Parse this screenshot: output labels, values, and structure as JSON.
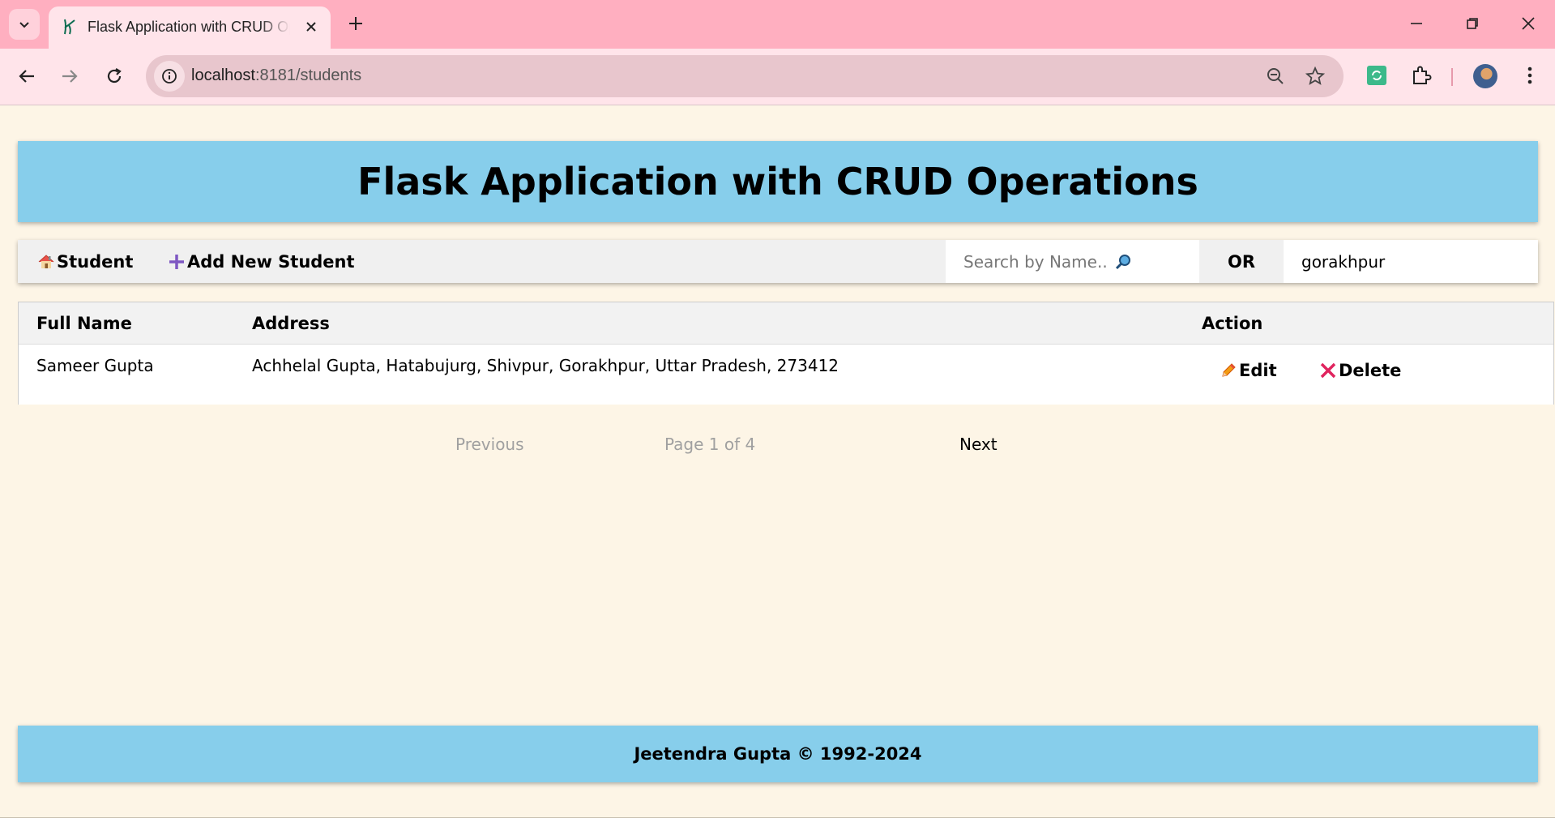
{
  "browser": {
    "tab_title": "Flask Application with CRUD Operations",
    "url_host": "localhost",
    "url_path": ":8181/students"
  },
  "page": {
    "title": "Flask Application with CRUD Operations",
    "nav": {
      "home_label": "Student",
      "add_label": "Add New Student",
      "search_name_placeholder": "Search by Name..",
      "or_label": "OR",
      "search_address_value": "gorakhpur"
    },
    "table": {
      "columns": [
        "Full Name",
        "Address",
        "Action"
      ],
      "rows": [
        {
          "full_name": "Sameer Gupta",
          "address": "Achhelal Gupta, Hatabujurg, Shivpur, Gorakhpur, Uttar Pradesh, 273412",
          "edit_label": "Edit",
          "delete_label": "Delete"
        }
      ]
    },
    "pagination": {
      "previous_label": "Previous",
      "page_info": "Page 1 of 4",
      "next_label": "Next"
    },
    "footer": "Jeetendra Gupta © 1992-2024"
  },
  "colors": {
    "header_bg": "#87ceeb",
    "page_bg": "#fdf5e6",
    "browser_frame": "#ffafc0"
  }
}
